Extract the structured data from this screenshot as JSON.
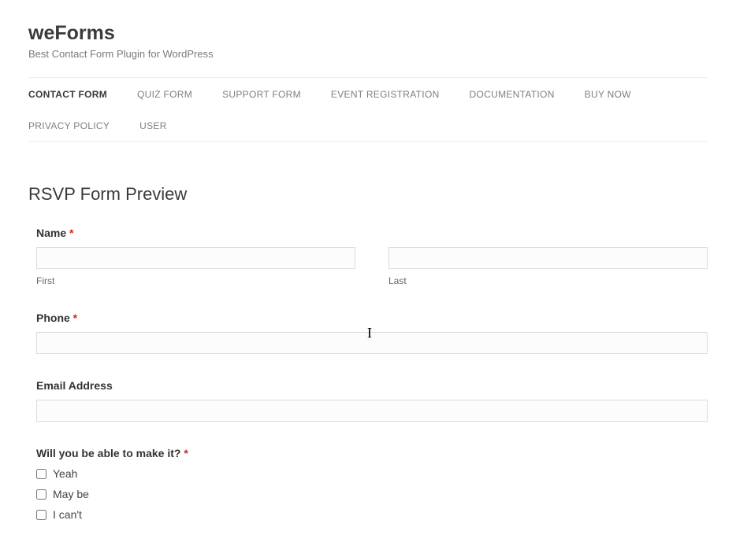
{
  "site": {
    "title": "weForms",
    "tagline": "Best Contact Form Plugin for WordPress"
  },
  "nav": {
    "items": [
      {
        "label": "CONTACT FORM",
        "active": true
      },
      {
        "label": "QUIZ FORM",
        "active": false
      },
      {
        "label": "SUPPORT FORM",
        "active": false
      },
      {
        "label": "EVENT REGISTRATION",
        "active": false
      },
      {
        "label": "DOCUMENTATION",
        "active": false
      },
      {
        "label": "BUY NOW",
        "active": false
      },
      {
        "label": "PRIVACY POLICY",
        "active": false
      },
      {
        "label": "USER",
        "active": false
      }
    ]
  },
  "page": {
    "heading": "RSVP Form Preview"
  },
  "form": {
    "name": {
      "label": "Name",
      "required": "*",
      "first_sub": "First",
      "last_sub": "Last",
      "first_value": "",
      "last_value": ""
    },
    "phone": {
      "label": "Phone",
      "required": "*",
      "value": ""
    },
    "email": {
      "label": "Email Address",
      "value": ""
    },
    "attend": {
      "label": "Will you be able to make it?",
      "required": "*",
      "options": [
        {
          "label": "Yeah"
        },
        {
          "label": "May be"
        },
        {
          "label": "I can't"
        }
      ]
    }
  }
}
